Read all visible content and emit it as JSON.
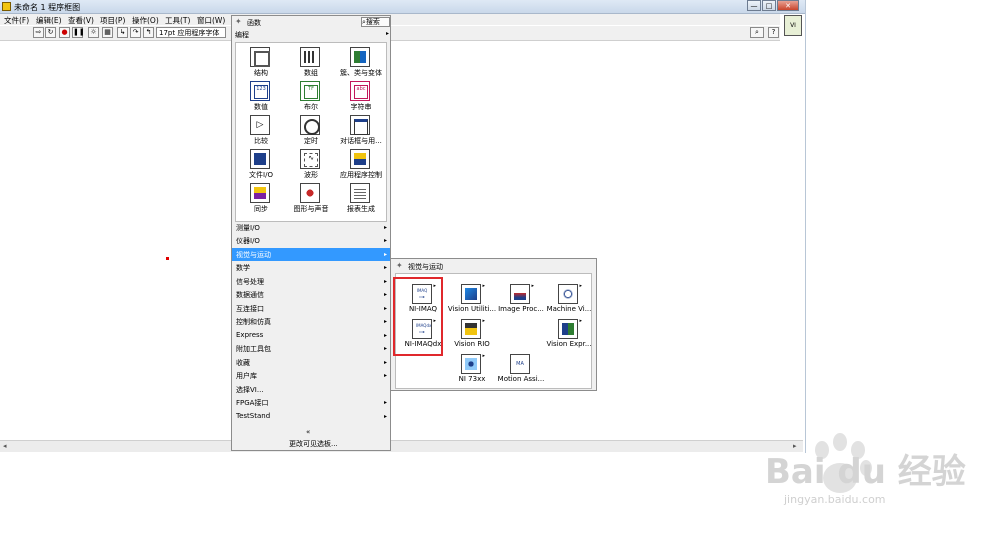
{
  "window": {
    "title": "未命名 1 程序框图",
    "controls": {
      "minimize": "—",
      "maximize": "□",
      "close": "✕"
    }
  },
  "menubar": [
    "文件(F)",
    "编辑(E)",
    "查看(V)",
    "项目(P)",
    "操作(O)",
    "工具(T)",
    "窗口(W)"
  ],
  "toolbar": {
    "font_label": "17pt 应用程序字体"
  },
  "palette": {
    "title": "函数",
    "search_label": "搜索",
    "section_label": "编程",
    "programming_items": [
      {
        "label": "结构",
        "icon": "structures-icon"
      },
      {
        "label": "数组",
        "icon": "array-icon"
      },
      {
        "label": "簇、类与变体",
        "icon": "cluster-icon"
      },
      {
        "label": "数值",
        "icon": "numeric-icon"
      },
      {
        "label": "布尔",
        "icon": "boolean-icon"
      },
      {
        "label": "字符串",
        "icon": "string-icon"
      },
      {
        "label": "比较",
        "icon": "comparison-icon"
      },
      {
        "label": "定时",
        "icon": "timing-icon"
      },
      {
        "label": "对话框与用...",
        "icon": "dialog-icon"
      },
      {
        "label": "文件I/O",
        "icon": "file-io-icon"
      },
      {
        "label": "波形",
        "icon": "waveform-icon"
      },
      {
        "label": "应用程序控制",
        "icon": "app-control-icon"
      },
      {
        "label": "同步",
        "icon": "sync-icon"
      },
      {
        "label": "图形与声音",
        "icon": "graphics-sound-icon"
      },
      {
        "label": "报表生成",
        "icon": "report-icon"
      }
    ],
    "categories": [
      "测量I/O",
      "仪器I/O",
      "视觉与运动",
      "数学",
      "信号处理",
      "数据通信",
      "互连接口",
      "控制和仿真",
      "Express",
      "附加工具包",
      "收藏",
      "用户库",
      "选择VI...",
      "FPGA接口",
      "TestStand"
    ],
    "selected_category": "视觉与运动",
    "expand_label": "«",
    "change_visible_label": "更改可见选板..."
  },
  "subpalette": {
    "title": "视觉与运动",
    "items": [
      {
        "label": "NI-IMAQ",
        "icon": "ni-imaq-icon"
      },
      {
        "label": "Vision Utiliti...",
        "icon": "vision-utilities-icon"
      },
      {
        "label": "Image Proc...",
        "icon": "image-processing-icon"
      },
      {
        "label": "Machine Vi...",
        "icon": "machine-vision-icon"
      },
      {
        "label": "NI-IMAQdx",
        "icon": "ni-imaqdx-icon"
      },
      {
        "label": "Vision RIO",
        "icon": "vision-rio-icon"
      },
      {
        "label": "Vision Expr...",
        "icon": "vision-express-icon"
      },
      {
        "label": "NI 73xx",
        "icon": "ni-73xx-icon"
      },
      {
        "label": "Motion Assi...",
        "icon": "motion-assistant-icon"
      }
    ]
  },
  "watermark": {
    "brand": "Bai du 经验",
    "url": "jingyan.baidu.com"
  },
  "colors": {
    "selection": "#3399ff",
    "highlight_box": "#e0282c",
    "palette_bg": "#f0f0f0"
  }
}
